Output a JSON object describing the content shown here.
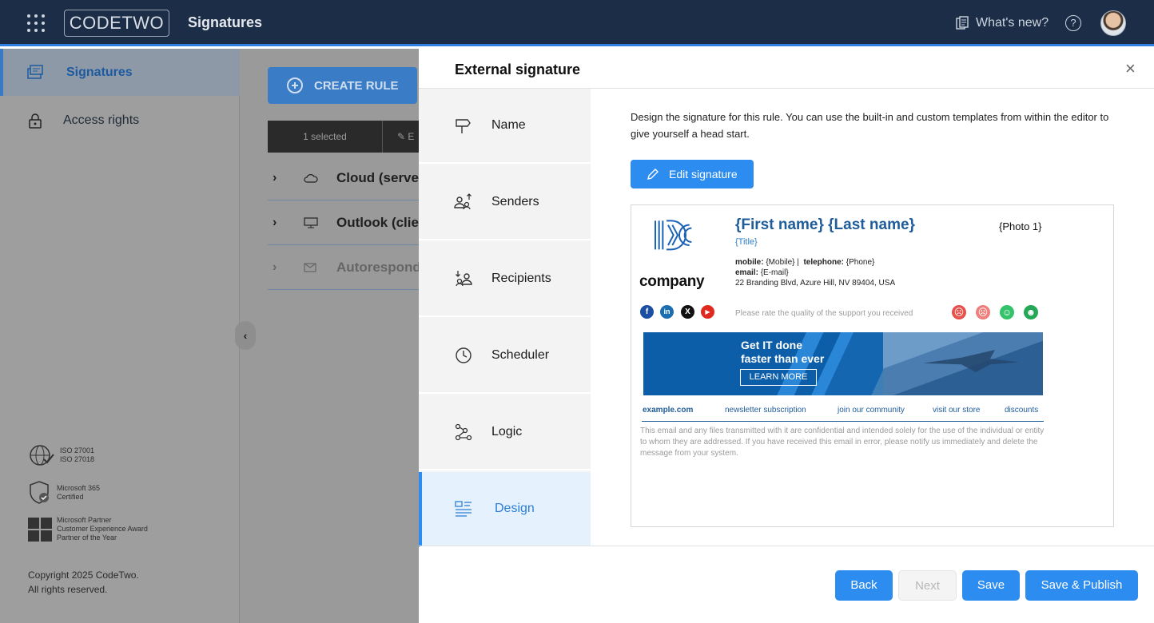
{
  "topbar": {
    "logo_text": "CODETWO",
    "app_title": "Signatures",
    "whats_new": "What's new?",
    "help": "?"
  },
  "sidebar": {
    "items": [
      {
        "label": "Signatures",
        "icon": "signatures-icon",
        "active": true
      },
      {
        "label": "Access rights",
        "icon": "lock-icon",
        "active": false
      }
    ],
    "certs": [
      {
        "lines": [
          "ISO 27001",
          "ISO 27018"
        ]
      },
      {
        "lines": [
          "Microsoft 365",
          "Certified"
        ]
      },
      {
        "lines": [
          "Microsoft Partner",
          "Customer Experience Award",
          "Partner of the Year"
        ]
      }
    ],
    "copyright": [
      "Copyright 2025 CodeTwo.",
      "All rights reserved."
    ]
  },
  "main": {
    "create_rule": "CREATE RULE",
    "selected": "1 selected",
    "edit_partial": "E",
    "groups": [
      {
        "label": "Cloud (serve",
        "icon": "cloud-icon"
      },
      {
        "label": "Outlook (clie",
        "icon": "monitor-icon"
      },
      {
        "label": "Autorespond",
        "icon": "autoresponder-icon"
      }
    ],
    "collapse": "‹"
  },
  "panel": {
    "title": "External signature",
    "close": "×",
    "steps": [
      {
        "label": "Name",
        "icon": "signpost-icon"
      },
      {
        "label": "Senders",
        "icon": "senders-icon"
      },
      {
        "label": "Recipients",
        "icon": "recipients-icon"
      },
      {
        "label": "Scheduler",
        "icon": "clock-icon"
      },
      {
        "label": "Logic",
        "icon": "logic-icon"
      },
      {
        "label": "Design",
        "icon": "design-icon",
        "active": true
      }
    ],
    "description": "Design the signature for this rule. You can use the built-in and custom templates from within the editor to give yourself a head start.",
    "edit_signature": "Edit signature",
    "buttons": {
      "back": "Back",
      "next": "Next",
      "save": "Save",
      "save_publish": "Save & Publish"
    }
  },
  "signature": {
    "company": "company",
    "name": "{First name} {Last name}",
    "title": "{Title}",
    "photo": "{Photo 1}",
    "mobile_label": "mobile:",
    "mobile": "{Mobile}",
    "separator": "|",
    "telephone_label": "telephone:",
    "telephone": "{Phone}",
    "email_label": "email:",
    "email": "{E-mail}",
    "address": "22 Branding Blvd, Azure Hill, NV 89404, USA",
    "social": [
      {
        "icon": "facebook-icon",
        "glyph": "f",
        "color": "#1a4fa3"
      },
      {
        "icon": "linkedin-icon",
        "glyph": "in",
        "color": "#1b6fb0"
      },
      {
        "icon": "x-icon",
        "glyph": "X",
        "color": "#111111"
      },
      {
        "icon": "youtube-icon",
        "glyph": "▶",
        "color": "#e02a20"
      }
    ],
    "rating_text": "Please rate the quality of the support you received",
    "faces": [
      {
        "icon": "very-sad-face-icon",
        "glyph": "☹",
        "color": "#e8504b"
      },
      {
        "icon": "sad-face-icon",
        "glyph": "☹",
        "color": "#ef7f7c"
      },
      {
        "icon": "happy-face-icon",
        "glyph": "☺",
        "color": "#34c26a"
      },
      {
        "icon": "very-happy-face-icon",
        "glyph": "☻",
        "color": "#24a855"
      }
    ],
    "banner": {
      "line1": "Get IT done",
      "line2": "faster than ever",
      "button": "LEARN MORE"
    },
    "links": [
      "example.com",
      "newsletter subscription",
      "join our community",
      "visit our store",
      "discounts"
    ],
    "disclaimer": "This email and any files transmitted with it are confidential and intended solely for the use of the individual or entity to whom they are addressed. If you have received this email in error, please notify us immediately and delete the message from your system."
  },
  "colors": {
    "accent": "#2d8cf0",
    "topbar": "#1b2d47",
    "signature_blue": "#1f5c9a"
  }
}
